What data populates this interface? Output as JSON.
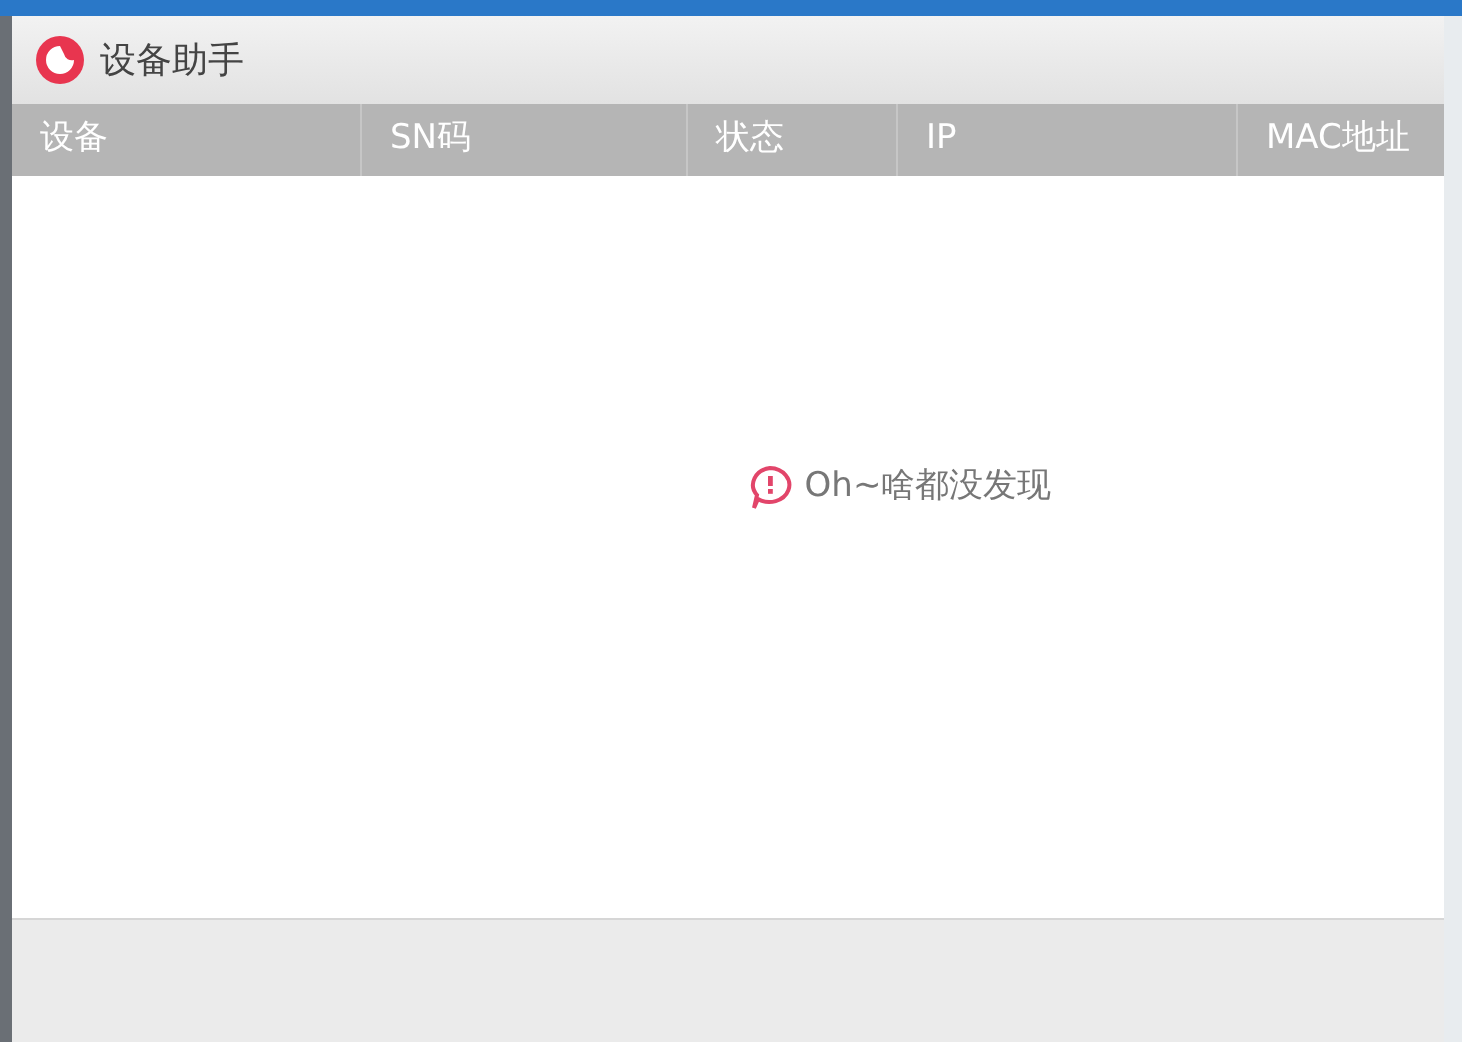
{
  "window": {
    "title": "设备助手"
  },
  "table": {
    "columns": [
      "设备",
      "SN码",
      "状态",
      "IP",
      "MAC地址"
    ]
  },
  "empty_state": {
    "message": "Oh~啥都没发现"
  }
}
